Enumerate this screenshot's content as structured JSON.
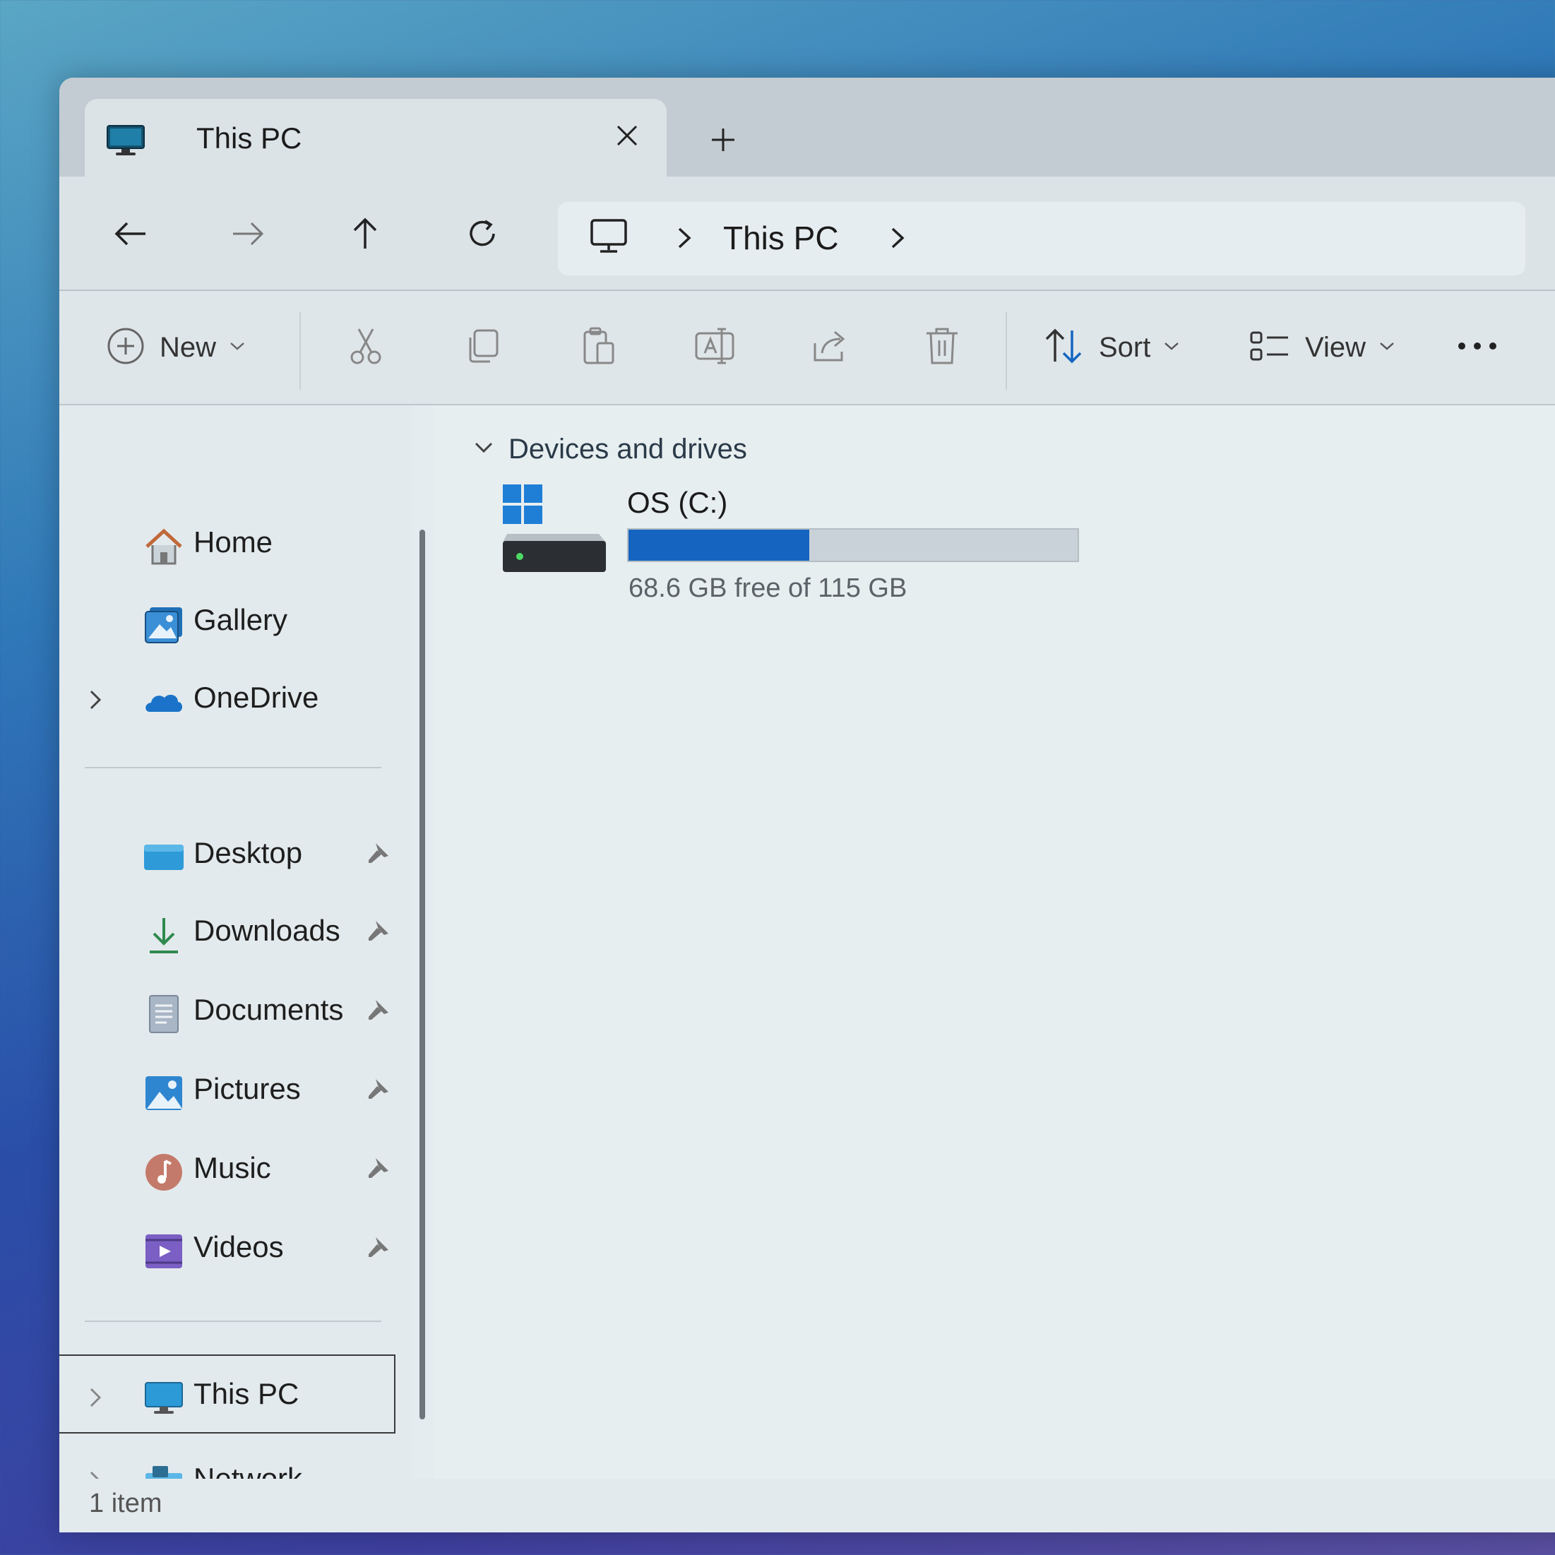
{
  "tab": {
    "title": "This PC"
  },
  "address": {
    "crumb": "This PC"
  },
  "commands": {
    "new_label": "New",
    "sort_label": "Sort",
    "view_label": "View"
  },
  "sidebar": {
    "items": [
      {
        "label": "Home",
        "icon": "home-icon"
      },
      {
        "label": "Gallery",
        "icon": "gallery-icon"
      },
      {
        "label": "OneDrive",
        "icon": "onedrive-icon"
      },
      {
        "label": "Desktop",
        "icon": "desktop-folder-icon",
        "pinned": true
      },
      {
        "label": "Downloads",
        "icon": "downloads-icon",
        "pinned": true
      },
      {
        "label": "Documents",
        "icon": "documents-icon",
        "pinned": true
      },
      {
        "label": "Pictures",
        "icon": "pictures-icon",
        "pinned": true
      },
      {
        "label": "Music",
        "icon": "music-icon",
        "pinned": true
      },
      {
        "label": "Videos",
        "icon": "videos-icon",
        "pinned": true
      },
      {
        "label": "This PC",
        "icon": "this-pc-icon",
        "selected": true
      },
      {
        "label": "Network",
        "icon": "network-icon"
      }
    ]
  },
  "content": {
    "group_label": "Devices and drives",
    "drives": [
      {
        "name": "OS (C:)",
        "free_text": "68.6 GB free of 115 GB",
        "used_fraction": 0.403
      }
    ]
  },
  "status": {
    "text": "1 item"
  },
  "colors": {
    "accent": "#1565c0",
    "bar_bg": "#c9d2d8"
  }
}
